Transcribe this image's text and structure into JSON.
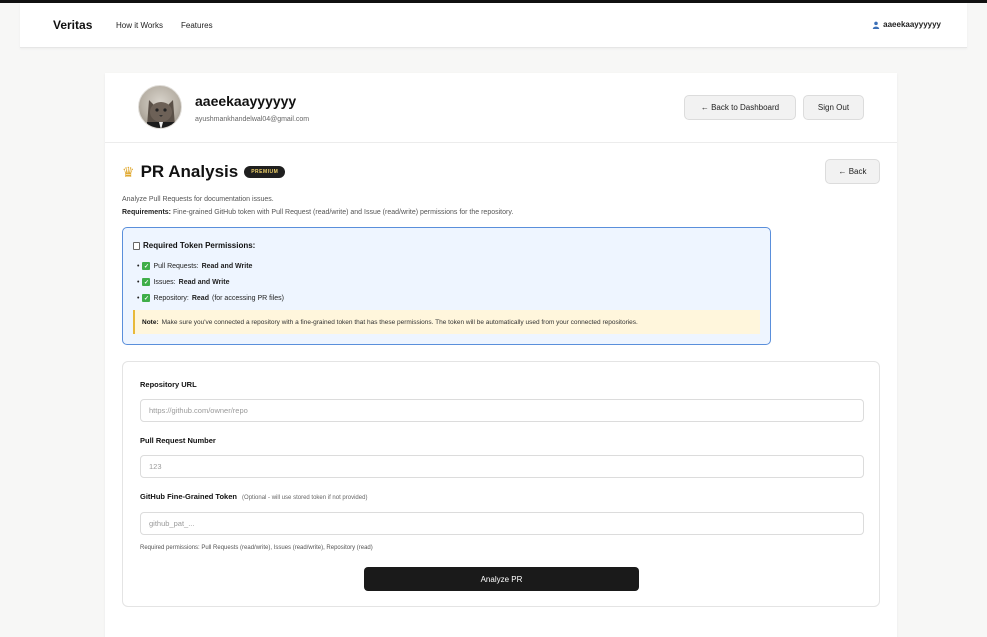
{
  "nav": {
    "brand": "Veritas",
    "links": [
      "How it Works",
      "Features"
    ],
    "user": "aaeekaayyyyyy"
  },
  "profile": {
    "username": "aaeekaayyyyyy",
    "email": "ayushmankhandelwal04@gmail.com",
    "back_dashboard_label": "← Back to Dashboard",
    "sign_out_label": "Sign Out"
  },
  "section": {
    "icon": "crown-icon",
    "title": "PR Analysis",
    "badge": "PREMIUM",
    "back_label": "← Back",
    "description": "Analyze Pull Requests for documentation issues.",
    "requirements_label": "Requirements:",
    "requirements_text": "Fine-grained GitHub token with Pull Request (read/write) and Issue (read/write) permissions for the repository."
  },
  "permissions": {
    "title": "Required Token Permissions:",
    "items": [
      {
        "name": "Pull Requests: ",
        "value": "Read and Write",
        "extra": ""
      },
      {
        "name": "Issues: ",
        "value": "Read and Write",
        "extra": ""
      },
      {
        "name": "Repository: ",
        "value": "Read",
        "extra": " (for accessing PR files)"
      }
    ],
    "note_label": "Note:",
    "note_text": "Make sure you've connected a repository with a fine-grained token that has these permissions. The token will be automatically used from your connected repositories."
  },
  "form": {
    "repo_label": "Repository URL",
    "repo_placeholder": "https://github.com/owner/repo",
    "pr_label": "Pull Request Number",
    "pr_placeholder": "123",
    "token_label": "GitHub Fine-Grained Token",
    "token_hint": "(Optional - will use stored token if not provided)",
    "token_placeholder": "github_pat_...",
    "help_text": "Required permissions: Pull Requests (read/write), Issues (read/write), Repository (read)",
    "submit_label": "Analyze PR"
  }
}
